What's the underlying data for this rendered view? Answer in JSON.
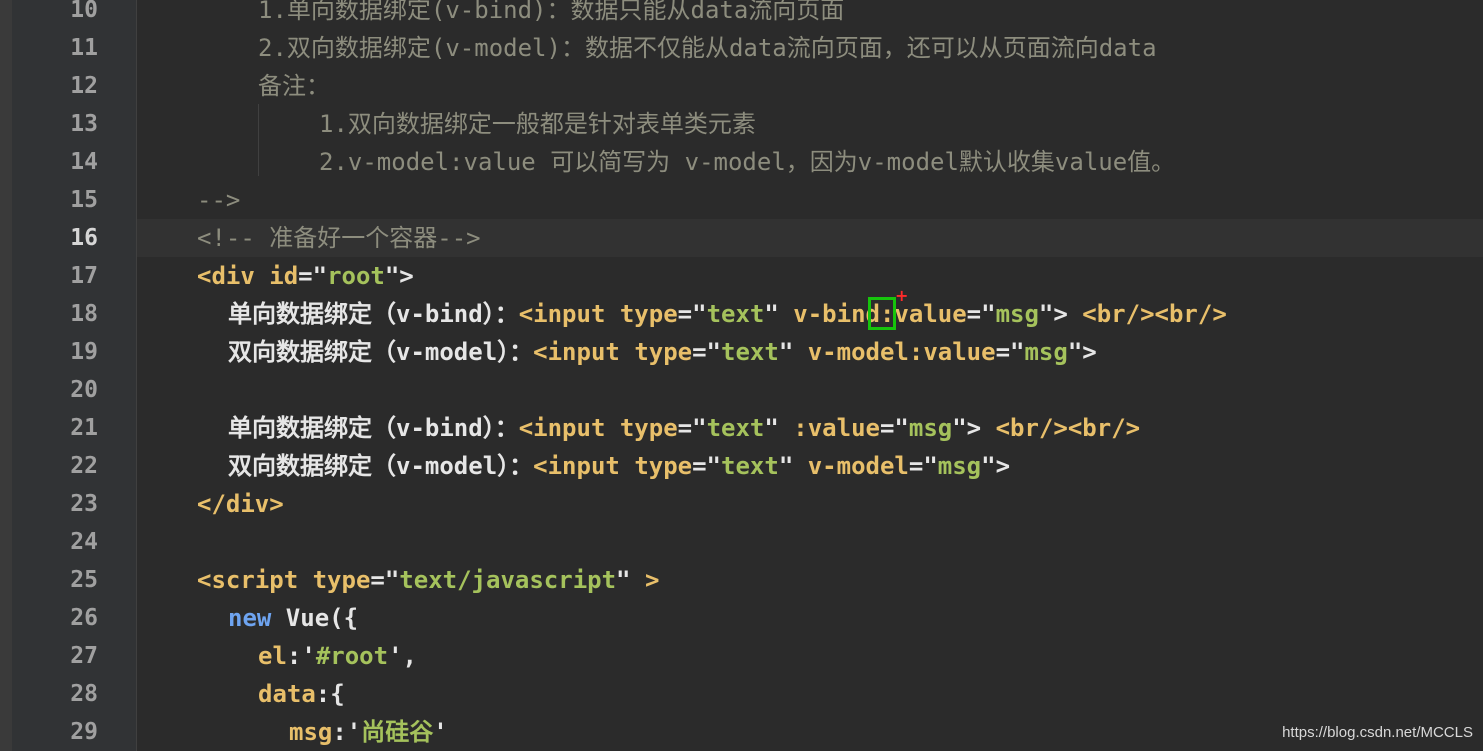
{
  "editor": {
    "lines": [
      {
        "num": "10",
        "parts": [
          {
            "t": "1.单向数据绑定(v-bind)：数据只能从data流向页面",
            "c": "c-comment"
          }
        ]
      },
      {
        "num": "11",
        "parts": [
          {
            "t": "2.双向数据绑定(v-model)：数据不仅能从data流向页面，还可以从页面流向data",
            "c": "c-comment"
          }
        ]
      },
      {
        "num": "12",
        "parts": [
          {
            "t": "备注：",
            "c": "c-comment"
          }
        ]
      },
      {
        "num": "13",
        "parts": [
          {
            "t": "1.双向数据绑定一般都是针对表单类元素",
            "c": "c-comment"
          }
        ]
      },
      {
        "num": "14",
        "parts": [
          {
            "t": "2.v-model:value 可以简写为 v-model，因为v-model默认收集value值。",
            "c": "c-comment"
          }
        ]
      },
      {
        "num": "15",
        "parts": [
          {
            "t": "-->",
            "c": "c-comment"
          }
        ]
      },
      {
        "num": "16",
        "parts": [
          {
            "t": "<!-- 准备好一个容器-->",
            "c": "c-comment"
          }
        ]
      },
      {
        "num": "17",
        "parts": [
          {
            "t": "<div ",
            "c": "c-tag c-bold"
          },
          {
            "t": "id",
            "c": "c-attr c-bold"
          },
          {
            "t": "=\"",
            "c": "c-white c-bold"
          },
          {
            "t": "root",
            "c": "c-str c-bold"
          },
          {
            "t": "\">",
            "c": "c-white c-bold"
          }
        ]
      },
      {
        "num": "18",
        "parts": [
          {
            "t": "单向数据绑定（v-bind）：",
            "c": "c-white c-bold"
          },
          {
            "t": "<input ",
            "c": "c-tag c-bold"
          },
          {
            "t": "type",
            "c": "c-attr c-bold"
          },
          {
            "t": "=\"",
            "c": "c-white c-bold"
          },
          {
            "t": "text",
            "c": "c-str c-bold"
          },
          {
            "t": "\" ",
            "c": "c-white c-bold"
          },
          {
            "t": "v-bind:value",
            "c": "c-attr c-bold"
          },
          {
            "t": "=\"",
            "c": "c-white c-bold"
          },
          {
            "t": "msg",
            "c": "c-str c-bold"
          },
          {
            "t": "\"> ",
            "c": "c-white c-bold"
          },
          {
            "t": "<br/><br/>",
            "c": "c-tag c-bold"
          }
        ]
      },
      {
        "num": "19",
        "parts": [
          {
            "t": "双向数据绑定（v-model）：",
            "c": "c-white c-bold"
          },
          {
            "t": "<input ",
            "c": "c-tag c-bold"
          },
          {
            "t": "type",
            "c": "c-attr c-bold"
          },
          {
            "t": "=\"",
            "c": "c-white c-bold"
          },
          {
            "t": "text",
            "c": "c-str c-bold"
          },
          {
            "t": "\" ",
            "c": "c-white c-bold"
          },
          {
            "t": "v-model:value",
            "c": "c-attr c-bold"
          },
          {
            "t": "=\"",
            "c": "c-white c-bold"
          },
          {
            "t": "msg",
            "c": "c-str c-bold"
          },
          {
            "t": "\">",
            "c": "c-white c-bold"
          }
        ]
      },
      {
        "num": "20",
        "parts": []
      },
      {
        "num": "21",
        "parts": [
          {
            "t": "单向数据绑定（v-bind）：",
            "c": "c-white c-bold"
          },
          {
            "t": "<input ",
            "c": "c-tag c-bold"
          },
          {
            "t": "type",
            "c": "c-attr c-bold"
          },
          {
            "t": "=\"",
            "c": "c-white c-bold"
          },
          {
            "t": "text",
            "c": "c-str c-bold"
          },
          {
            "t": "\" ",
            "c": "c-white c-bold"
          },
          {
            "t": ":value",
            "c": "c-attr c-bold"
          },
          {
            "t": "=\"",
            "c": "c-white c-bold"
          },
          {
            "t": "msg",
            "c": "c-str c-bold"
          },
          {
            "t": "\"> ",
            "c": "c-white c-bold"
          },
          {
            "t": "<br/><br/>",
            "c": "c-tag c-bold"
          }
        ]
      },
      {
        "num": "22",
        "parts": [
          {
            "t": "双向数据绑定（v-model）：",
            "c": "c-white c-bold"
          },
          {
            "t": "<input ",
            "c": "c-tag c-bold"
          },
          {
            "t": "type",
            "c": "c-attr c-bold"
          },
          {
            "t": "=\"",
            "c": "c-white c-bold"
          },
          {
            "t": "text",
            "c": "c-str c-bold"
          },
          {
            "t": "\" ",
            "c": "c-white c-bold"
          },
          {
            "t": "v-model",
            "c": "c-attr c-bold"
          },
          {
            "t": "=\"",
            "c": "c-white c-bold"
          },
          {
            "t": "msg",
            "c": "c-str c-bold"
          },
          {
            "t": "\">",
            "c": "c-white c-bold"
          }
        ]
      },
      {
        "num": "23",
        "parts": [
          {
            "t": "</div>",
            "c": "c-tag c-bold"
          }
        ]
      },
      {
        "num": "24",
        "parts": []
      },
      {
        "num": "25",
        "parts": [
          {
            "t": "<script ",
            "c": "c-tag c-bold"
          },
          {
            "t": "type",
            "c": "c-attr c-bold"
          },
          {
            "t": "=\"",
            "c": "c-white c-bold"
          },
          {
            "t": "text/javascript",
            "c": "c-str c-bold"
          },
          {
            "t": "\" ",
            "c": "c-white c-bold"
          },
          {
            "t": ">",
            "c": "c-tag c-bold"
          }
        ]
      },
      {
        "num": "26",
        "parts": [
          {
            "t": "new ",
            "c": "c-blue c-bold"
          },
          {
            "t": "Vue({",
            "c": "c-white c-bold"
          }
        ]
      },
      {
        "num": "27",
        "parts": [
          {
            "t": "el",
            "c": "c-prop c-bold"
          },
          {
            "t": ":'",
            "c": "c-white c-bold"
          },
          {
            "t": "#root",
            "c": "c-str c-bold"
          },
          {
            "t": "',",
            "c": "c-white c-bold"
          }
        ]
      },
      {
        "num": "28",
        "parts": [
          {
            "t": "data",
            "c": "c-prop c-bold"
          },
          {
            "t": ":{",
            "c": "c-white c-bold"
          }
        ]
      },
      {
        "num": "29",
        "parts": [
          {
            "t": "msg",
            "c": "c-prop c-bold"
          },
          {
            "t": ":'",
            "c": "c-white c-bold"
          },
          {
            "t": "尚硅谷",
            "c": "c-str c-bold"
          },
          {
            "t": "'",
            "c": "c-white c-bold"
          }
        ]
      }
    ],
    "current_line": "16",
    "watermark": "https://blog.csdn.net/MCCLS"
  }
}
